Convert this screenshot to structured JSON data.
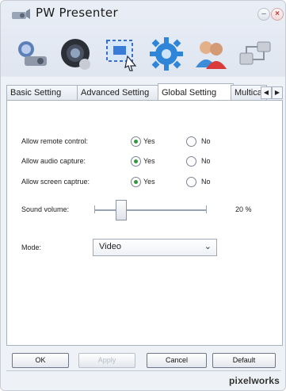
{
  "window": {
    "title": "PW Presenter",
    "minimize_glyph": "–",
    "close_glyph": "×"
  },
  "toolbar": {
    "icons": [
      {
        "name": "presenter-tool-icon"
      },
      {
        "name": "camera-lens-icon"
      },
      {
        "name": "screen-capture-icon"
      },
      {
        "name": "settings-gear-icon"
      },
      {
        "name": "users-icon"
      },
      {
        "name": "network-devices-icon"
      }
    ]
  },
  "tabs": [
    {
      "label": "Basic Setting"
    },
    {
      "label": "Advanced Setting"
    },
    {
      "label": "Global Setting"
    },
    {
      "label": "Multica"
    }
  ],
  "tab_scroll": {
    "left": "◀",
    "right": "▶"
  },
  "settings": {
    "remote_control": {
      "label": "Allow remote control:",
      "yes": "Yes",
      "no": "No"
    },
    "audio_capture": {
      "label": "Allow audio capture:",
      "yes": "Yes",
      "no": "No"
    },
    "screen_capture": {
      "label": "Allow screen captrue:",
      "yes": "Yes",
      "no": "No"
    },
    "sound_volume": {
      "label": "Sound volume:",
      "value_text": "20 %",
      "value": 20
    },
    "mode": {
      "label": "Mode:",
      "selected": "Video"
    }
  },
  "buttons": {
    "ok": "OK",
    "apply": "Apply",
    "cancel": "Cancel",
    "default": "Default"
  },
  "brand": "pixelworks",
  "colors": {
    "radio_selected": "#2f9a3b",
    "brand_dot": "#e0262a"
  }
}
